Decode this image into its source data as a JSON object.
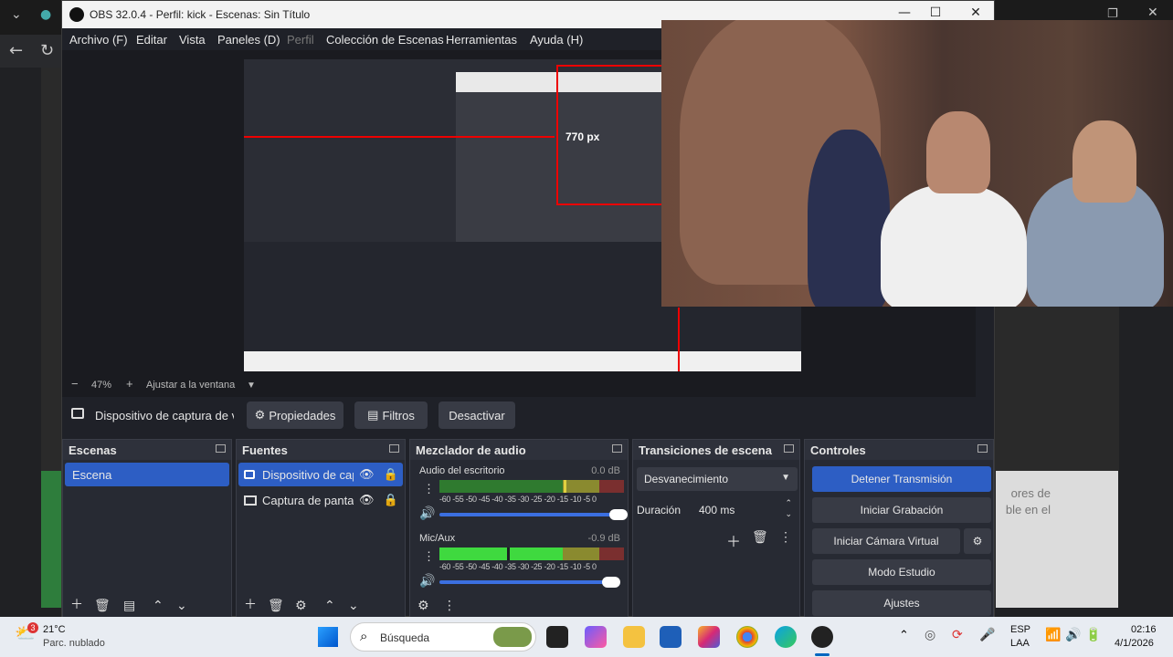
{
  "window": {
    "title": "OBS 32.0.4 - Perfil: kick - Escenas: Sin Título"
  },
  "menu": [
    "Archivo (F)",
    "Editar",
    "Vista",
    "Paneles (D)",
    "Perfil",
    "Colección de Escenas",
    "Herramientas",
    "Ayuda (H)"
  ],
  "preview": {
    "px_label": "770 px"
  },
  "zoom": {
    "minus": "−",
    "level": "47%",
    "plus": "+",
    "fit": "Ajustar a la ventana"
  },
  "sourcebar": {
    "source_name": "Dispositivo de captura de v",
    "properties": "Propiedades",
    "filters": "Filtros",
    "deactivate": "Desactivar"
  },
  "scenes": {
    "title": "Escenas",
    "items": [
      "Escena"
    ]
  },
  "sources": {
    "title": "Fuentes",
    "items": [
      "Dispositivo de cap",
      "Captura de panta"
    ]
  },
  "mixer": {
    "title": "Mezclador de audio",
    "channels": [
      {
        "name": "Audio del escritorio",
        "db": "0.0 dB",
        "scale": "-60 -55 -50 -45 -40 -35 -30 -25 -20 -15 -10 -5 0"
      },
      {
        "name": "Mic/Aux",
        "db": "-0.9 dB",
        "scale": "-60 -55 -50 -45 -40 -35 -30 -25 -20 -15 -10 -5 0"
      }
    ]
  },
  "transitions": {
    "title": "Transiciones de escena",
    "selected": "Desvanecimiento",
    "duration_label": "Duración",
    "duration_value": "400 ms"
  },
  "controls": {
    "title": "Controles",
    "stop_stream": "Detener Transmisión",
    "start_recording": "Iniciar Grabación",
    "start_virtual_cam": "Iniciar Cámara Virtual",
    "studio_mode": "Modo Estudio",
    "settings": "Ajustes"
  },
  "background_chat": "ores de\nble en el",
  "taskbar": {
    "weather_badge": "3",
    "temp": "21°C",
    "weather": "Parc. nublado",
    "search": "Búsqueda",
    "lang1": "ESP",
    "lang2": "LAA",
    "time": "02:16",
    "date": "4/1/2026"
  },
  "colors": {
    "accent": "#2d5ec4",
    "meter_green": "#3fd93f",
    "meter_yellow": "#c8c832",
    "meter_red": "#d43030"
  }
}
